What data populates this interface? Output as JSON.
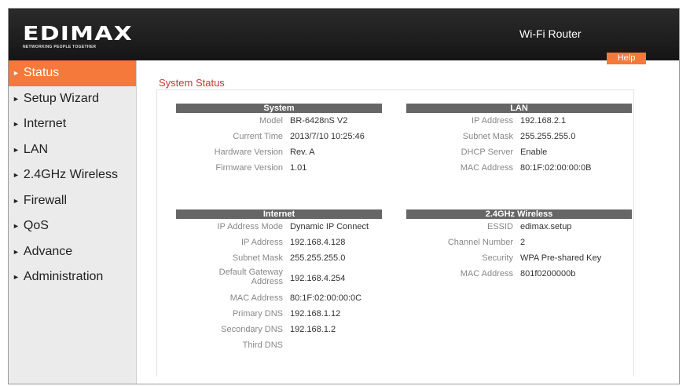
{
  "header": {
    "logo_text": "EDIMAX",
    "logo_tagline": "NETWORKING PEOPLE TOGETHER",
    "product_name": "Wi-Fi Router"
  },
  "sidebar": {
    "items": [
      {
        "label": "Status",
        "active": true
      },
      {
        "label": "Setup Wizard"
      },
      {
        "label": "Internet"
      },
      {
        "label": "LAN"
      },
      {
        "label": "2.4GHz Wireless"
      },
      {
        "label": "Firewall"
      },
      {
        "label": "QoS"
      },
      {
        "label": "Advance"
      },
      {
        "label": "Administration"
      }
    ]
  },
  "help_label": "Help",
  "page_title": "System Status",
  "system": {
    "title": "System",
    "rows": [
      {
        "label": "Model",
        "value": "BR-6428nS V2"
      },
      {
        "label": "Current Time",
        "value": "2013/7/10  10:25:46"
      },
      {
        "label": "Hardware Version",
        "value": "Rev. A"
      },
      {
        "label": "Firmware Version",
        "value": "1.01"
      }
    ]
  },
  "lan": {
    "title": "LAN",
    "rows": [
      {
        "label": "IP Address",
        "value": "192.168.2.1"
      },
      {
        "label": "Subnet Mask",
        "value": "255.255.255.0"
      },
      {
        "label": "DHCP Server",
        "value": "Enable"
      },
      {
        "label": "MAC Address",
        "value": "80:1F:02:00:00:0B"
      }
    ]
  },
  "internet": {
    "title": "Internet",
    "rows": [
      {
        "label": "IP Address Mode",
        "value": "Dynamic IP  Connect"
      },
      {
        "label": "IP Address",
        "value": "192.168.4.128"
      },
      {
        "label": "Subnet Mask",
        "value": "255.255.255.0"
      },
      {
        "label": "Default Gateway Address",
        "value": "192.168.4.254"
      },
      {
        "label": "MAC Address",
        "value": "80:1F:02:00:00:0C"
      },
      {
        "label": "Primary DNS",
        "value": "192.168.1.12"
      },
      {
        "label": "Secondary DNS",
        "value": "192.168.1.2"
      },
      {
        "label": "Third DNS",
        "value": ""
      }
    ]
  },
  "wireless": {
    "title": "2.4GHz  Wireless",
    "rows": [
      {
        "label": "ESSID",
        "value": "edimax.setup"
      },
      {
        "label": "Channel Number",
        "value": "2"
      },
      {
        "label": "Security",
        "value": "WPA Pre-shared Key"
      },
      {
        "label": "MAC Address",
        "value": "801f0200000b"
      }
    ]
  },
  "colors": {
    "accent": "#f4793b",
    "title_red": "#c0392b",
    "section_header": "#666666",
    "header_bg": "#1e1e1e",
    "sidebar_bg": "#ebebeb"
  }
}
